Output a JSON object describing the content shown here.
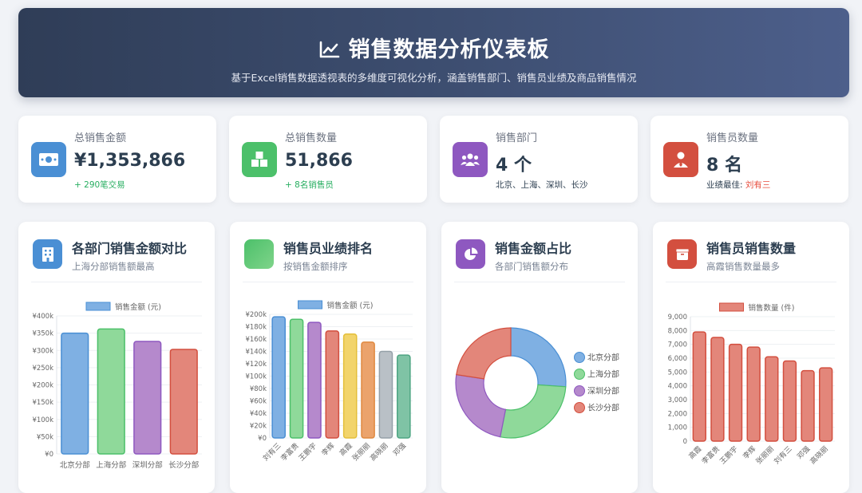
{
  "header": {
    "title": "销售数据分析仪表板",
    "subtitle": "基于Excel销售数据透视表的多维度可视化分析，涵盖销售部门、销售员业绩及商品销售情况"
  },
  "stats": [
    {
      "label": "总销售金额",
      "value": "¥1,353,866",
      "sub": "+ 290笔交易",
      "icon": "money-icon",
      "color": "#4a8fd4"
    },
    {
      "label": "总销售数量",
      "value": "51,866",
      "sub": "+ 8名销售员",
      "icon": "boxes-icon",
      "color": "#4cc06a"
    },
    {
      "label": "销售部门",
      "value": "4 个",
      "sub": "北京、上海、深圳、长沙",
      "icon": "users-icon",
      "color": "#8e58c0"
    },
    {
      "label": "销售员数量",
      "value": "8 名",
      "sub_prefix": "业绩最佳: ",
      "sub_highlight": "刘有三",
      "icon": "user-tie-icon",
      "color": "#d34f3f"
    }
  ],
  "cards": [
    {
      "title": "各部门销售金额对比",
      "subtitle": "上海分部销售额最高",
      "icon": "building-icon",
      "color": "#4a8fd4"
    },
    {
      "title": "销售员业绩排名",
      "subtitle": "按销售金额排序",
      "icon": "trophy-icon",
      "color": "#4cc06a"
    },
    {
      "title": "销售金额占比",
      "subtitle": "各部门销售额分布",
      "icon": "pie-chart-icon",
      "color": "#8e58c0"
    },
    {
      "title": "销售员销售数量",
      "subtitle": "高霞销售数量最多",
      "icon": "box-icon",
      "color": "#d34f3f"
    }
  ],
  "chart_data": [
    {
      "type": "bar",
      "categories": [
        "北京分部",
        "上海分部",
        "深圳分部",
        "长沙分部"
      ],
      "series": [
        {
          "name": "销售金额 (元)",
          "values": [
            350000,
            362000,
            326000,
            303000
          ]
        }
      ],
      "colors": [
        "#7fb0e3",
        "#8fd99a",
        "#b589cc",
        "#e3867a"
      ],
      "borders": [
        "#4a8fd4",
        "#4cc06a",
        "#8e58c0",
        "#d34f3f"
      ],
      "ylim": [
        0,
        400000
      ],
      "yticks": [
        "¥0",
        "¥50k",
        "¥100k",
        "¥150k",
        "¥200k",
        "¥250k",
        "¥300k",
        "¥350k",
        "¥400k"
      ],
      "legend": "top"
    },
    {
      "type": "bar",
      "categories": [
        "刘有三",
        "李富贵",
        "王鹏宇",
        "李辉",
        "高霞",
        "张丽丽",
        "高晓丽",
        "邓强"
      ],
      "series": [
        {
          "name": "销售金额 (元)",
          "values": [
            196000,
            192000,
            187000,
            173000,
            168000,
            155000,
            140000,
            134000
          ]
        }
      ],
      "colors": [
        "#7fb0e3",
        "#8fd99a",
        "#b589cc",
        "#e3867a",
        "#f2d46b",
        "#eba36c",
        "#b9c0c6",
        "#7fc3a5"
      ],
      "borders": [
        "#4a8fd4",
        "#4cc06a",
        "#8e58c0",
        "#d34f3f",
        "#e4bf3a",
        "#e0893f",
        "#95a0a8",
        "#4ea583"
      ],
      "ylim": [
        0,
        200000
      ],
      "yticks": [
        "¥0",
        "¥20k",
        "¥40k",
        "¥60k",
        "¥80k",
        "¥100k",
        "¥120k",
        "¥140k",
        "¥160k",
        "¥180k",
        "¥200k"
      ],
      "legend": "top"
    },
    {
      "type": "pie",
      "labels": [
        "北京分部",
        "上海分部",
        "深圳分部",
        "长沙分部"
      ],
      "values": [
        350000,
        362000,
        326000,
        303000
      ],
      "colors": [
        "#7fb0e3",
        "#8fd99a",
        "#b589cc",
        "#e3867a"
      ],
      "borders": [
        "#4a8fd4",
        "#4cc06a",
        "#8e58c0",
        "#d34f3f"
      ],
      "legend": "right"
    },
    {
      "type": "bar",
      "categories": [
        "高霞",
        "李富贵",
        "王鹏宇",
        "李辉",
        "张丽丽",
        "刘有三",
        "邓强",
        "高晓丽"
      ],
      "series": [
        {
          "name": "销售数量 (件)",
          "values": [
            7900,
            7500,
            7000,
            6800,
            6100,
            5800,
            5100,
            5300
          ]
        }
      ],
      "colors": [
        "#e3867a",
        "#e3867a",
        "#e3867a",
        "#e3867a",
        "#e3867a",
        "#e3867a",
        "#e3867a",
        "#e3867a"
      ],
      "borders": [
        "#d34f3f",
        "#d34f3f",
        "#d34f3f",
        "#d34f3f",
        "#d34f3f",
        "#d34f3f",
        "#d34f3f",
        "#d34f3f"
      ],
      "ylim": [
        0,
        9000
      ],
      "yticks": [
        "0",
        "1,000",
        "2,000",
        "3,000",
        "4,000",
        "5,000",
        "6,000",
        "7,000",
        "8,000",
        "9,000"
      ],
      "legend": "top"
    }
  ]
}
